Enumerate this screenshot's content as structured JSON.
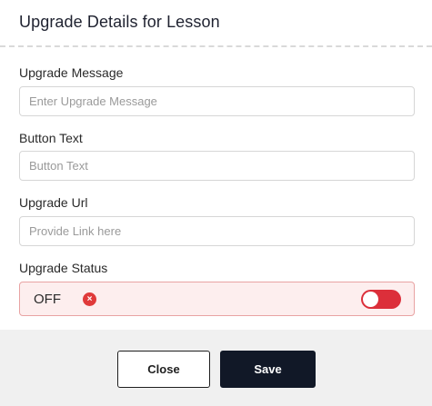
{
  "header": {
    "title": "Upgrade Details for Lesson"
  },
  "form": {
    "message": {
      "label": "Upgrade Message",
      "placeholder": "Enter Upgrade Message",
      "value": ""
    },
    "button_text": {
      "label": "Button Text",
      "placeholder": "Button Text",
      "value": ""
    },
    "url": {
      "label": "Upgrade Url",
      "placeholder": "Provide Link here",
      "value": ""
    },
    "status": {
      "label": "Upgrade Status",
      "value_text": "OFF",
      "enabled": false,
      "x_glyph": "×"
    }
  },
  "footer": {
    "close_label": "Close",
    "save_label": "Save"
  },
  "colors": {
    "toggle_off": "#dc2f3a",
    "status_bg": "#fdeeee",
    "save_bg": "#111827"
  },
  "icons": {
    "status_icon": "close-circle-icon"
  }
}
